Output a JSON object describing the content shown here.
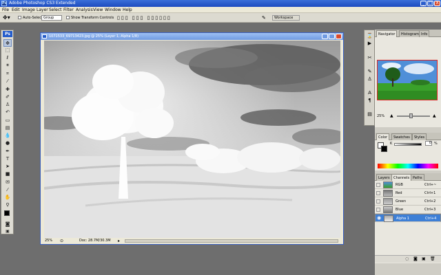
{
  "app": {
    "title": "Adobe Photoshop CS3 Extended"
  },
  "window_controls": {
    "minimize": "_",
    "maximize": "□",
    "close": "X"
  },
  "menu": [
    "File",
    "Edit",
    "Image",
    "Layer",
    "Select",
    "Filter",
    "Analysis",
    "View",
    "Window",
    "Help"
  ],
  "options_bar": {
    "auto_select_label": "Auto-Select:",
    "auto_select_value": "Group",
    "show_transform_label": "Show Transform Controls",
    "workspace_label": "Workspace"
  },
  "toolbox": {
    "logo": "Ps"
  },
  "document": {
    "title": "1071533_69713423.jpg @ 25% (Layer 1, Alpha 1/8)",
    "zoom": "25%",
    "doc_info": "Doc: 28.7M/30.3M"
  },
  "navigator": {
    "tabs": [
      "Navigator",
      "Histogram",
      "Info"
    ],
    "zoom": "25%"
  },
  "color_panel": {
    "tabs": [
      "Color",
      "Swatches",
      "Styles"
    ],
    "channel_label": "K",
    "value": "0",
    "unit": "%"
  },
  "channels_panel": {
    "tabs": [
      "Layers",
      "Channels",
      "Paths"
    ],
    "rows": [
      {
        "name": "RGB",
        "shortcut": "Ctrl+~"
      },
      {
        "name": "Red",
        "shortcut": "Ctrl+1"
      },
      {
        "name": "Green",
        "shortcut": "Ctrl+2"
      },
      {
        "name": "Blue",
        "shortcut": "Ctrl+3"
      },
      {
        "name": "Alpha 1",
        "shortcut": "Ctrl+4"
      }
    ],
    "selected": "Alpha 1"
  },
  "colors": {
    "titlebar": "#1d4bbf",
    "selection": "#3d7fd6",
    "sky": "#4f8fd8",
    "grass": "#3aa12a"
  }
}
